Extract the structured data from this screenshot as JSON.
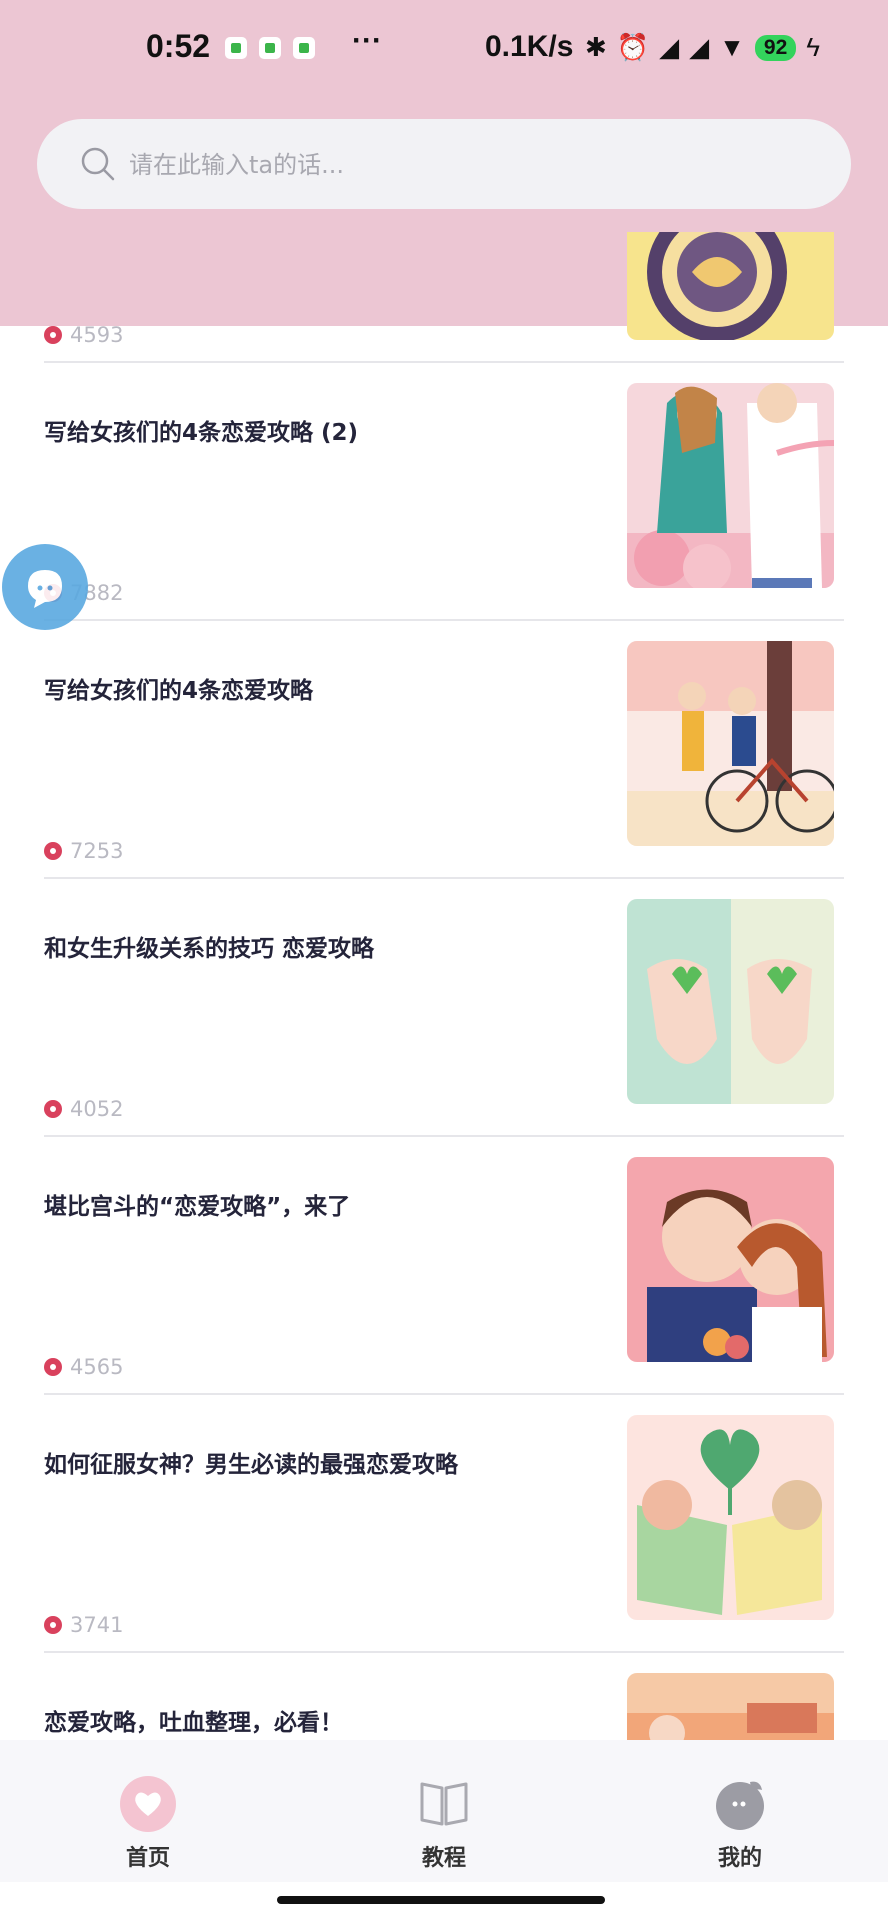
{
  "status_bar": {
    "time": "0:52",
    "dots": "···",
    "network_speed": "0.1K/s",
    "battery": "92"
  },
  "search": {
    "placeholder": "请在此输入ta的话..."
  },
  "partial_article": {
    "views": "4593"
  },
  "articles": [
    {
      "title": "写给女孩们的4条恋爱攻略 (2)",
      "views": "7882",
      "thumb": "couple-with-gift"
    },
    {
      "title": "写给女孩们的4条恋爱攻略",
      "views": "7253",
      "thumb": "couple-with-bicycle"
    },
    {
      "title": "和女生升级关系的技巧  恋爱攻略",
      "views": "4052",
      "thumb": "hands-with-hearts"
    },
    {
      "title": "堪比宫斗的“恋爱攻略”，来了",
      "views": "4565",
      "thumb": "groom-and-bride"
    },
    {
      "title": "如何征服女神？男生必读的最强恋爱攻略",
      "views": "3741",
      "thumb": "couple-with-books"
    },
    {
      "title": "恋爱攻略，吐血整理，必看！",
      "views": "",
      "thumb": "room-scene"
    }
  ],
  "tabbar": {
    "home": "首页",
    "tutorial": "教程",
    "mine": "我的"
  },
  "colors": {
    "header_pink": "#ecc6d3",
    "accent_red": "#d9415d",
    "floating_blue": "#5aa9e0"
  }
}
